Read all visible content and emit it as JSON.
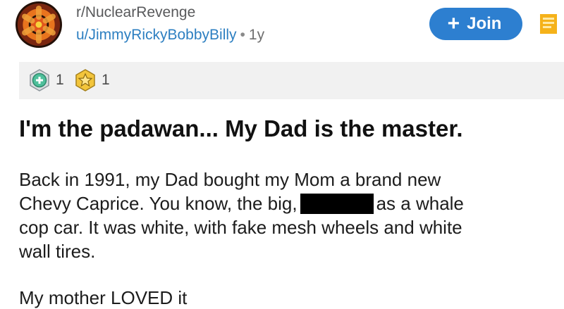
{
  "header": {
    "community": "r/NuclearRevenge",
    "username": "u/JimmyRickyBobbyBilly",
    "separator": "•",
    "age": "1y",
    "join_label": "Join"
  },
  "awards": [
    {
      "icon": "helpful-award-icon",
      "count": "1"
    },
    {
      "icon": "wholesome-award-icon",
      "count": "1"
    }
  ],
  "post": {
    "title": "I'm the padawan... My Dad is the master.",
    "body_lines": [
      "Back in 1991, my Dad bought my Mom a brand new",
      "Chevy Caprice.  You know, the big,",
      "as a whale",
      "cop car.  It was white, with fake mesh wheels and white",
      "wall tires."
    ],
    "next_paragraph_partial": "My mother LOVED it"
  },
  "colors": {
    "join_button": "#2d7fd0",
    "username": "#2d7fc1",
    "save_icon": "#f5b21a",
    "awards_bar": "#f1f1f1"
  }
}
